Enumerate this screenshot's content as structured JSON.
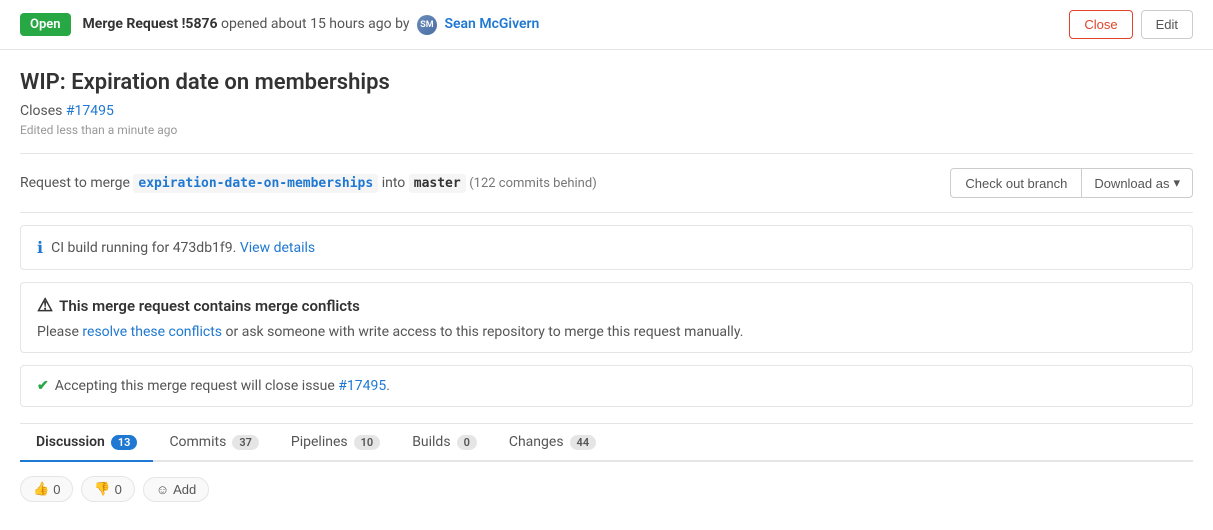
{
  "topbar": {
    "badge": "Open",
    "mr_text": "Merge Request !5876 opened about 15 hours ago by",
    "author": "Sean McGivern",
    "author_initials": "SM",
    "close_label": "Close",
    "edit_label": "Edit"
  },
  "mr": {
    "title": "WIP: Expiration date on memberships",
    "closes_prefix": "Closes ",
    "closes_link": "#17495",
    "edited_text": "Edited less than a minute ago",
    "merge_text": "Request to merge",
    "source_branch": "expiration-date-on-memberships",
    "into_text": "into",
    "target_branch": "master",
    "commits_behind": "(122 commits behind)"
  },
  "actions": {
    "checkout": "Check out branch",
    "download": "Download as",
    "chevron": "▾"
  },
  "ci": {
    "text": "CI build running for 473db1f9.",
    "link_text": "View details"
  },
  "conflict": {
    "icon": "⚠",
    "title": "This merge request contains merge conflicts",
    "desc_before": "Please ",
    "desc_link": "resolve these conflicts",
    "desc_after": " or ask someone with write access to this repository to merge this request manually."
  },
  "close_issue": {
    "check": "✔",
    "text_before": "Accepting this merge request will close issue ",
    "link": "#17495",
    "text_after": "."
  },
  "tabs": [
    {
      "label": "Discussion",
      "count": "13",
      "active": true
    },
    {
      "label": "Commits",
      "count": "37",
      "active": false
    },
    {
      "label": "Pipelines",
      "count": "10",
      "active": false
    },
    {
      "label": "Builds",
      "count": "0",
      "active": false
    },
    {
      "label": "Changes",
      "count": "44",
      "active": false
    }
  ],
  "reactions": [
    {
      "icon": "👍",
      "count": "0"
    },
    {
      "icon": "👎",
      "count": "0"
    }
  ],
  "add_reaction": "Add"
}
